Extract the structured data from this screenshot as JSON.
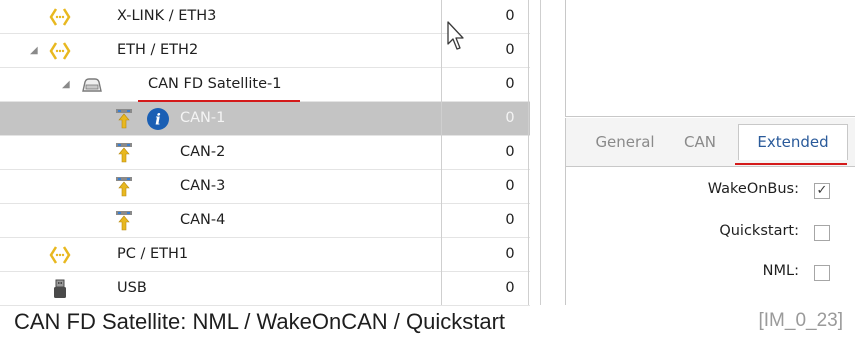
{
  "tree": {
    "rows": [
      {
        "label": "X-LINK / ETH3",
        "value": "0",
        "icon": "ethernet-port-icon"
      },
      {
        "label": "ETH / ETH2",
        "value": "0",
        "icon": "ethernet-port-icon",
        "expander": "◢"
      },
      {
        "label": "CAN FD Satellite-1",
        "value": "0",
        "icon": "satellite-device-icon",
        "expander": "◢"
      },
      {
        "label": "CAN-1",
        "value": "0",
        "icon": "can-channel-icon",
        "selected": true,
        "badge": "info-icon"
      },
      {
        "label": "CAN-2",
        "value": "0",
        "icon": "can-channel-icon"
      },
      {
        "label": "CAN-3",
        "value": "0",
        "icon": "can-channel-icon"
      },
      {
        "label": "CAN-4",
        "value": "0",
        "icon": "can-channel-icon"
      },
      {
        "label": "PC / ETH1",
        "value": "0",
        "icon": "ethernet-port-icon"
      },
      {
        "label": "USB",
        "value": "0",
        "icon": "usb-icon"
      }
    ]
  },
  "tabs": [
    {
      "label": "General",
      "active": false
    },
    {
      "label": "CAN",
      "active": false
    },
    {
      "label": "Extended",
      "active": true
    }
  ],
  "properties": [
    {
      "label": "WakeOnBus:",
      "checked": true
    },
    {
      "label": "Quickstart:",
      "checked": false
    },
    {
      "label": "NML:",
      "checked": false
    }
  ],
  "caption": "CAN FD Satellite: NML / WakeOnCAN / Quickstart",
  "figure_ref": "[IM_0_23]",
  "colors": {
    "annotation": "#d41a1a",
    "selection": "#c4c4c4",
    "eth_icon": "#e8b820",
    "can_icon_arrow": "#e8b820",
    "info_badge": "#1a5fb4",
    "active_tab_text": "#2a5a9a"
  }
}
